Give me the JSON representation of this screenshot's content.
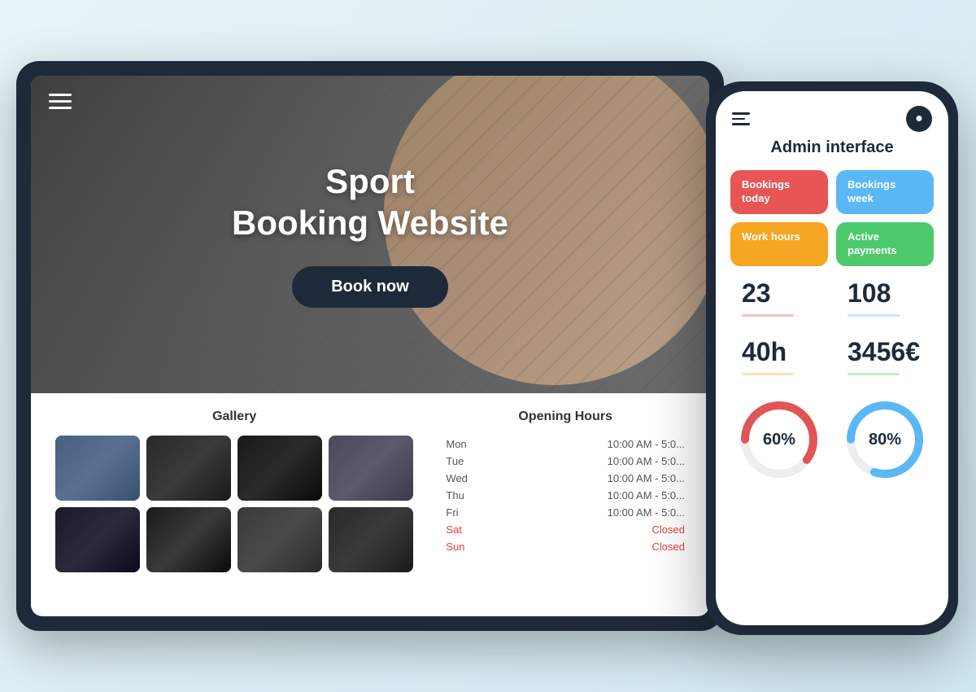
{
  "tablet": {
    "hero": {
      "title_line1": "Sport",
      "title_line2": "Booking Website",
      "book_button": "Book now"
    },
    "gallery": {
      "section_title": "Gallery",
      "items": [
        1,
        2,
        3,
        4,
        5,
        6,
        7,
        8
      ]
    },
    "opening_hours": {
      "section_title": "Opening Hours",
      "days": [
        {
          "day": "Mon",
          "time": "10:00 AM - 5:0...",
          "closed": false
        },
        {
          "day": "Tue",
          "time": "10:00 AM - 5:0...",
          "closed": false
        },
        {
          "day": "Wed",
          "time": "10:00 AM - 5:0...",
          "closed": false
        },
        {
          "day": "Thu",
          "time": "10:00 AM - 5:0...",
          "closed": false
        },
        {
          "day": "Fri",
          "time": "10:00 AM - 5:0...",
          "closed": false
        },
        {
          "day": "Sat",
          "time": "Closed",
          "closed": true
        },
        {
          "day": "Sun",
          "time": "Closed",
          "closed": true
        }
      ]
    }
  },
  "phone": {
    "admin_title": "Admin interface",
    "stats": [
      {
        "label": "Bookings today",
        "color": "red",
        "value": "23"
      },
      {
        "label": "Bookings week",
        "color": "blue",
        "value": "108"
      },
      {
        "label": "Work hours",
        "color": "yellow",
        "value": "40h"
      },
      {
        "label": "Active payments",
        "color": "green",
        "value": "3456€"
      }
    ],
    "charts": [
      {
        "label": "60%",
        "value": 60,
        "color": "#e05555"
      },
      {
        "label": "80%",
        "value": 80,
        "color": "#5bb8f5"
      }
    ]
  }
}
